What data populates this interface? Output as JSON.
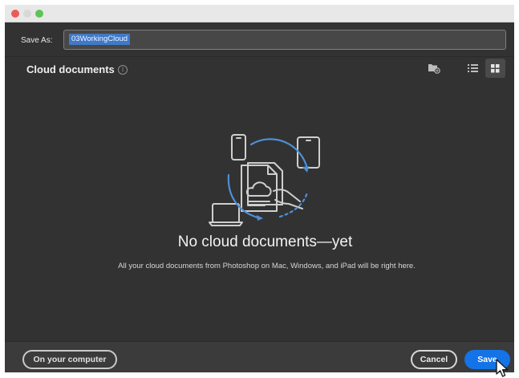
{
  "window": {
    "controls": [
      "close",
      "minimize",
      "zoom"
    ]
  },
  "save_as": {
    "label": "Save As:",
    "value": "03WorkingCloud"
  },
  "section": {
    "title": "Cloud documents",
    "info_icon": "i"
  },
  "toolbar": {
    "icons": [
      "new-folder-icon",
      "list-view-icon",
      "grid-view-icon"
    ],
    "active_view": "grid"
  },
  "empty_state": {
    "title": "No cloud documents—yet",
    "description": "All your cloud documents from Photoshop on Mac, Windows, and iPad will be right here."
  },
  "footer": {
    "on_computer": "On your computer",
    "cancel": "Cancel",
    "save": "Save"
  },
  "colors": {
    "background": "#323232",
    "accent": "#1473e6",
    "illustration_accent": "#4e8fd6"
  }
}
